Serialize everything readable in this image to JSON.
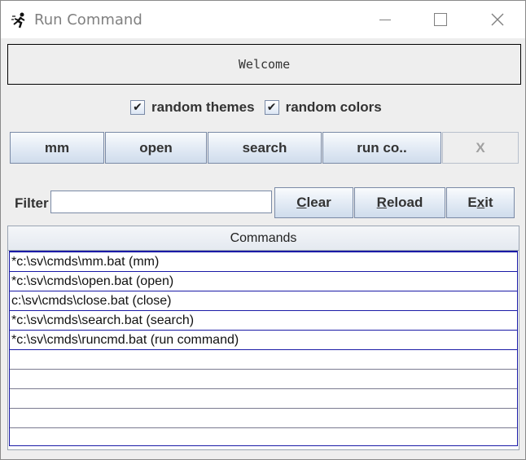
{
  "window": {
    "title": "Run Command",
    "controls": {
      "minimize": "minimize",
      "maximize": "maximize",
      "close": "close"
    }
  },
  "welcome": {
    "text": "Welcome"
  },
  "checkboxes": [
    {
      "label": "random themes",
      "checked": true
    },
    {
      "label": "random colors",
      "checked": true
    }
  ],
  "command_buttons": [
    {
      "label": "mm",
      "enabled": true
    },
    {
      "label": "open",
      "enabled": true
    },
    {
      "label": "search",
      "enabled": true
    },
    {
      "label": "run co..",
      "enabled": true
    },
    {
      "label": "X",
      "enabled": false
    }
  ],
  "filter": {
    "label": "Filter",
    "value": ""
  },
  "action_buttons": {
    "clear": {
      "mnemonic": "C",
      "rest": "lear"
    },
    "reload": {
      "mnemonic": "R",
      "rest": "eload"
    },
    "exit": {
      "pre": "E",
      "mnemonic": "x",
      "rest": "it"
    }
  },
  "table": {
    "header": "Commands",
    "rows": [
      "*c:\\sv\\cmds\\mm.bat (mm)",
      "*c:\\sv\\cmds\\open.bat (open)",
      "c:\\sv\\cmds\\close.bat (close)",
      "*c:\\sv\\cmds\\search.bat (search)",
      "*c:\\sv\\cmds\\runcmd.bat (run command)",
      "",
      "",
      "",
      "",
      ""
    ]
  },
  "colors": {
    "selection_border": "#1a1aa6",
    "button_gradient_top": "#f9fbfd",
    "button_gradient_bottom": "#cfdcec"
  }
}
